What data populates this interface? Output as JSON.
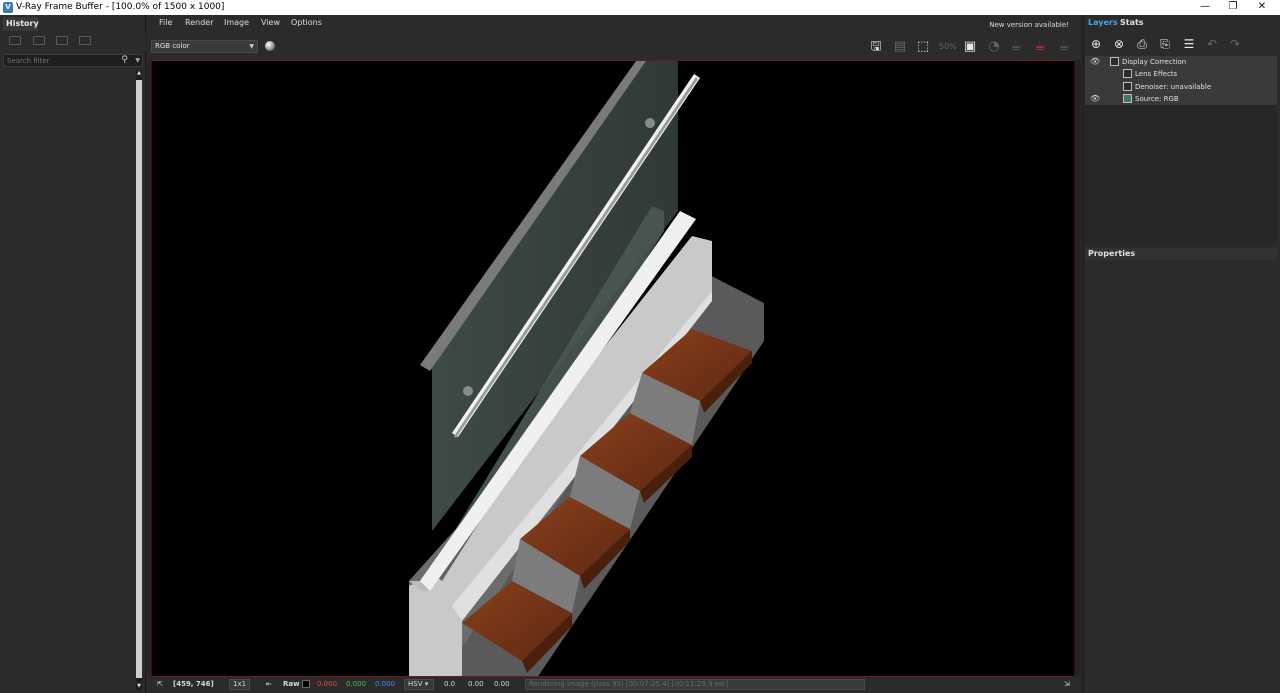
{
  "window": {
    "app_icon": "vray-icon",
    "title": "V-Ray Frame Buffer - [100.0% of 1500 x 1000]",
    "minimize": "—",
    "restore": "❐",
    "close": "✕"
  },
  "history": {
    "tab_label": "History",
    "search_placeholder": "Search filter"
  },
  "menu": {
    "items": [
      "File",
      "Render",
      "Image",
      "View",
      "Options"
    ],
    "notice": "New version available!"
  },
  "toolbar": {
    "channel": "RGB color",
    "icons": [
      "save-icon",
      "load-icon",
      "region-render-icon",
      "50-percent-icon",
      "crop-icon",
      "track-mouse-icon",
      "bucket-render-icon",
      "stop-render-icon",
      "render-icon"
    ]
  },
  "status": {
    "coords": "[459, 746]",
    "sample": "1x1",
    "raw_label": "Raw",
    "r": "0.000",
    "g": "0.000",
    "b": "0.000",
    "color_mode": "HSV",
    "h": "0.0",
    "s": "0.00",
    "v": "0.00",
    "progress_text": "Rendering image (pass 95) [00:07:25.4] [00:11:29.9 est]",
    "r_color": "#e04848",
    "g_color": "#4cc84c",
    "b_color": "#4a8ee6"
  },
  "right_panel": {
    "tab_layers": "Layers",
    "tab_stats": "Stats",
    "active_tab_color": "#4aa3e8",
    "layers": [
      {
        "name": "Display Correction",
        "indent": 0,
        "visible": true
      },
      {
        "name": "Lens Effects",
        "indent": 1,
        "visible": false
      },
      {
        "name": "Denoiser: unavailable",
        "indent": 1,
        "visible": false
      },
      {
        "name": "Source: RGB",
        "indent": 1,
        "visible": true
      }
    ],
    "properties_label": "Properties"
  }
}
